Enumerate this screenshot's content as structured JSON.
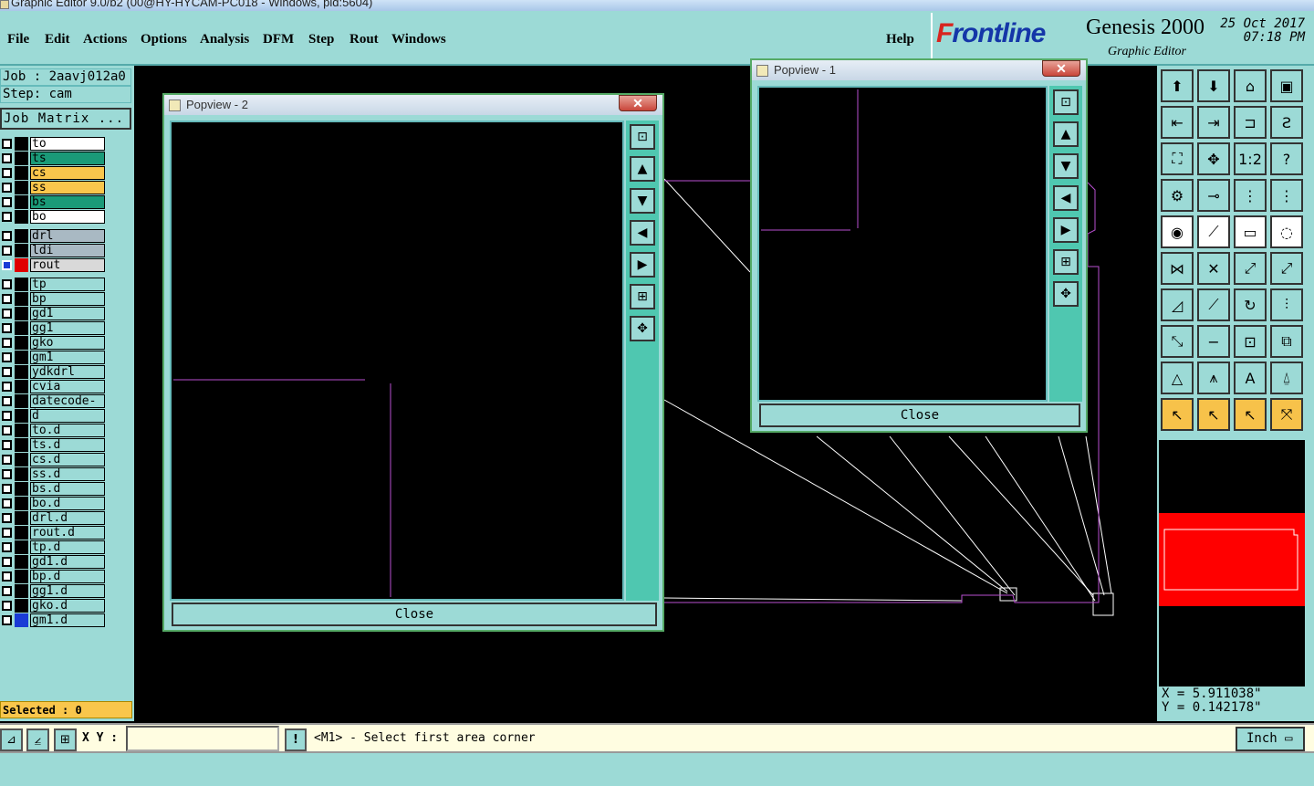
{
  "app": {
    "title": "Graphic Editor 9.0/b2 (00@HY-HYCAM-PC018 - Windows, pid:5604)"
  },
  "menu": [
    "File",
    "Edit",
    "Actions",
    "Options",
    "Analysis",
    "DFM",
    "Step",
    "Rout",
    "Windows"
  ],
  "help": "Help",
  "brand": {
    "logo_pre": "F",
    "logo_post": "rontline",
    "product": "Genesis 2000",
    "sub": "Graphic Editor",
    "date": "25 Oct 2017",
    "time": "07:18 PM"
  },
  "job": {
    "job": "Job : 2aavj012a0",
    "step": "Step: cam",
    "matrix": "Job Matrix ..."
  },
  "layers": [
    {
      "name": "to",
      "color": "#ffffff"
    },
    {
      "name": "ts",
      "color": "#1a9a78"
    },
    {
      "name": "cs",
      "color": "#f9c64c"
    },
    {
      "name": "ss",
      "color": "#f9c64c"
    },
    {
      "name": "bs",
      "color": "#1a9a78"
    },
    {
      "name": "bo",
      "color": "#ffffff"
    },
    {
      "name": "drl",
      "color": "#a9b9c3"
    },
    {
      "name": "ldi",
      "color": "#a9b9c3"
    },
    {
      "name": "rout",
      "color": "#d9d9d9",
      "active": true,
      "swatch": "#e00000"
    },
    {
      "name": "tp",
      "color": "#9cdad6"
    },
    {
      "name": "bp",
      "color": "#9cdad6"
    },
    {
      "name": "gd1",
      "color": "#9cdad6"
    },
    {
      "name": "gg1",
      "color": "#9cdad6"
    },
    {
      "name": "gko",
      "color": "#9cdad6"
    },
    {
      "name": "gm1",
      "color": "#9cdad6"
    },
    {
      "name": "ydkdrl",
      "color": "#9cdad6"
    },
    {
      "name": "cvia",
      "color": "#9cdad6"
    },
    {
      "name": "datecode-to",
      "color": "#9cdad6"
    },
    {
      "name": "d",
      "color": "#9cdad6"
    },
    {
      "name": "to.d",
      "color": "#9cdad6"
    },
    {
      "name": "ts.d",
      "color": "#9cdad6"
    },
    {
      "name": "cs.d",
      "color": "#9cdad6"
    },
    {
      "name": "ss.d",
      "color": "#9cdad6"
    },
    {
      "name": "bs.d",
      "color": "#9cdad6"
    },
    {
      "name": "bo.d",
      "color": "#9cdad6"
    },
    {
      "name": "drl.d",
      "color": "#9cdad6"
    },
    {
      "name": "rout.d",
      "color": "#9cdad6"
    },
    {
      "name": "tp.d",
      "color": "#9cdad6"
    },
    {
      "name": "gd1.d",
      "color": "#9cdad6"
    },
    {
      "name": "bp.d",
      "color": "#9cdad6"
    },
    {
      "name": "gg1.d",
      "color": "#9cdad6"
    },
    {
      "name": "gko.d",
      "color": "#9cdad6"
    },
    {
      "name": "gm1.d",
      "color": "#9cdad6",
      "swatch": "#1a3bd6"
    }
  ],
  "selected": "Selected : 0",
  "popview1": {
    "title": "Popview - 1",
    "close": "Close"
  },
  "popview2": {
    "title": "Popview - 2",
    "close": "Close"
  },
  "coords": {
    "x": "X = 5.911038\"",
    "y": "Y = 0.142178\""
  },
  "status": {
    "xy_label": "X Y :",
    "xy_value": "",
    "prompt": "<M1> - Select first area corner",
    "unit": "Inch"
  },
  "icons": [
    "pan-up-icon",
    "pan-down-icon",
    "home-icon",
    "zoom-fit-icon",
    "pan-left-icon",
    "pan-right-icon",
    "zoom-in-icon",
    "snap-icon",
    "fit-width-icon",
    "zoom-center-icon",
    "ratio-icon",
    "help-icon",
    "settings-icon",
    "measure-icon",
    "route-a-icon",
    "route-b-icon",
    "pad-icon",
    "line-icon",
    "ruler-icon",
    "circle-icon",
    "connect-icon",
    "cross-icon",
    "arc-a-icon",
    "arc-b-icon",
    "angle-icon",
    "slash-icon",
    "rotate-icon",
    "mirror-icon",
    "move-icon",
    "minus-icon",
    "box-icon",
    "group-icon",
    "tri-a-icon",
    "tri-b-icon",
    "tri-c-icon",
    "tri-d-icon",
    "select-icon",
    "select-box-icon",
    "select-poly-icon",
    "select-net-icon"
  ]
}
